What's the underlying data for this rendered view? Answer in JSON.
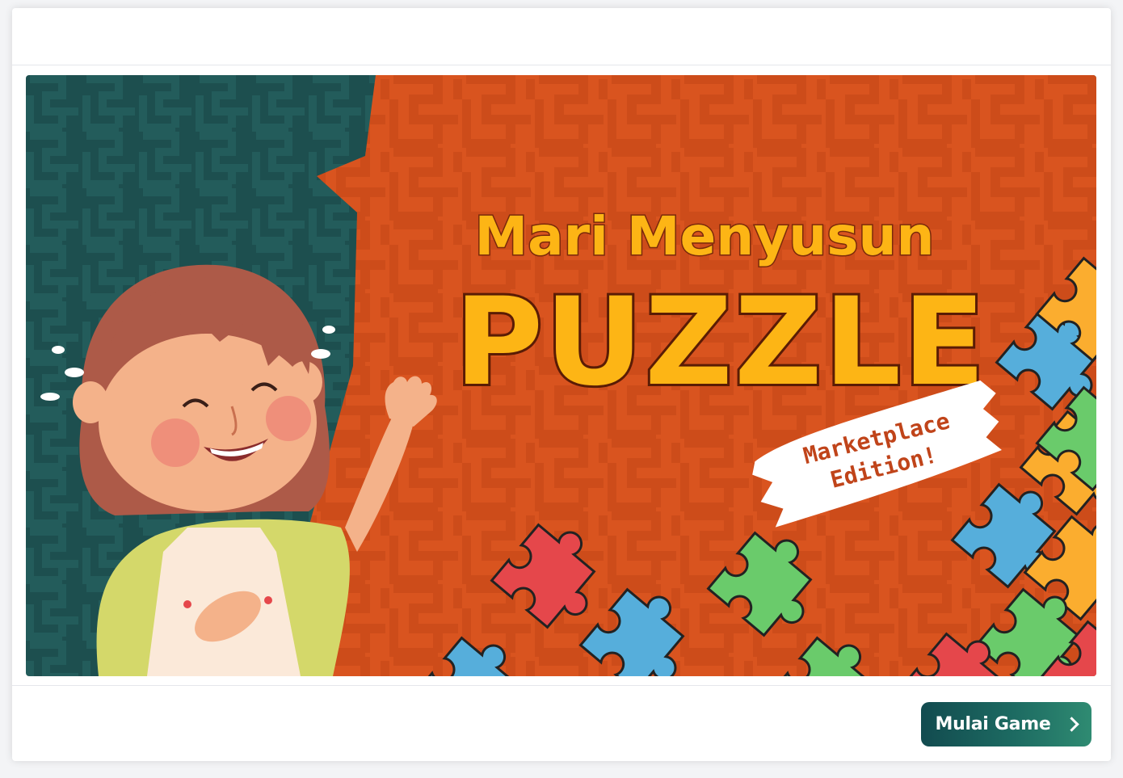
{
  "banner": {
    "title_line1": "Mari Menyusun",
    "title_line2": "PUZZLE",
    "tag_line1": "Marketplace",
    "tag_line2": "Edition!",
    "colors": {
      "teal_bg": "#1d4f4f",
      "orange_bg": "#d9541f",
      "title_yellow": "#fdb515",
      "puzzle_red": "#e5474b",
      "puzzle_blue": "#56aedb",
      "puzzle_green": "#6acb6b",
      "puzzle_orange": "#fbad2f"
    }
  },
  "footer": {
    "start_button_label": "Mulai Game",
    "start_button_icon": "chevron-right-icon"
  }
}
